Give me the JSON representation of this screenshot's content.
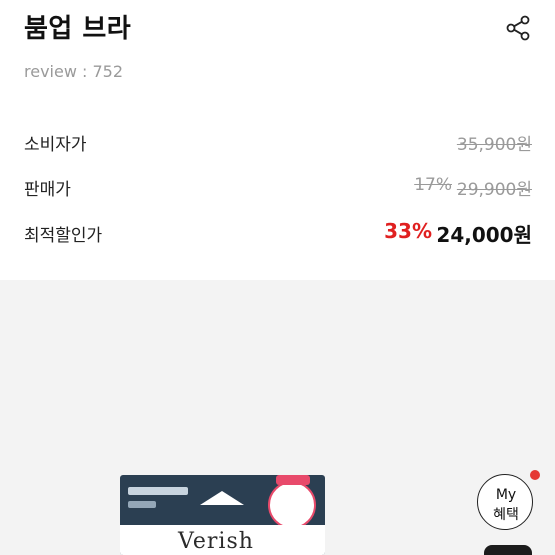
{
  "product": {
    "title": "붐업 브라",
    "review_label": "review : 752"
  },
  "prices": {
    "consumer_label": "소비자가",
    "consumer_price": "35,900원",
    "sale_label": "판매가",
    "sale_discount": "17%",
    "sale_price": "29,900원",
    "best_label": "최적할인가",
    "best_discount": "33%",
    "best_price": "24,000원"
  },
  "gallery": {
    "brand_text": "Verish"
  },
  "floating": {
    "my_line1": "My",
    "my_line2": "혜택"
  },
  "colors": {
    "accent_red": "#e02020",
    "muted_gray": "#9a9a9a",
    "gallery_bg": "#f3f3f3"
  },
  "icons": {
    "share": "share-icon"
  }
}
